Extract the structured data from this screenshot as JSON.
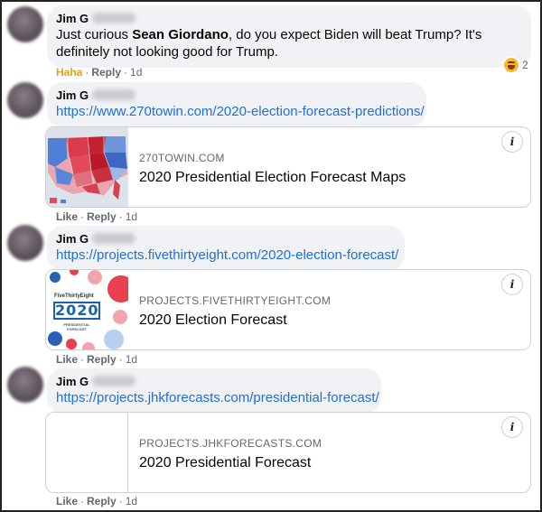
{
  "comments": [
    {
      "author": "Jim G",
      "text_pre": "Just curious ",
      "text_mention": "Sean Giordano",
      "text_post": ", do you expect Biden will beat Trump? It's definitely not looking good for Trump.",
      "actions": {
        "reaction_label": "Haha",
        "reply": "Reply",
        "time": "1d"
      },
      "reaction_count": "2"
    },
    {
      "author": "Jim G",
      "link": "https://www.270towin.com/2020-election-forecast-predictions/",
      "card": {
        "domain": "270TOWIN.COM",
        "title": "2020 Presidential Election Forecast Maps"
      },
      "actions": {
        "like": "Like",
        "reply": "Reply",
        "time": "1d"
      }
    },
    {
      "author": "Jim G",
      "link": "https://projects.fivethirtyeight.com/2020-election-forecast/",
      "card": {
        "domain": "PROJECTS.FIVETHIRTYEIGHT.COM",
        "title": "2020 Election Forecast",
        "thumb_logo": "FiveThirtyEight",
        "thumb_year": "2020",
        "thumb_sub": "PRESIDENTIAL FORECAST"
      },
      "actions": {
        "like": "Like",
        "reply": "Reply",
        "time": "1d"
      }
    },
    {
      "author": "Jim G",
      "link": "https://projects.jhkforecasts.com/presidential-forecast/",
      "card": {
        "domain": "PROJECTS.JHKFORECASTS.COM",
        "title": "2020 Presidential Forecast"
      },
      "actions": {
        "like": "Like",
        "reply": "Reply",
        "time": "1d"
      }
    }
  ],
  "separator": "·",
  "info_glyph": "i",
  "icons": {
    "reaction": "haha-emoji-icon",
    "card_info": "info-icon"
  },
  "colors": {
    "link": "#216fdb",
    "haha": "#e4a11b",
    "bubble": "#f0f2f5",
    "meta": "#65676b"
  }
}
